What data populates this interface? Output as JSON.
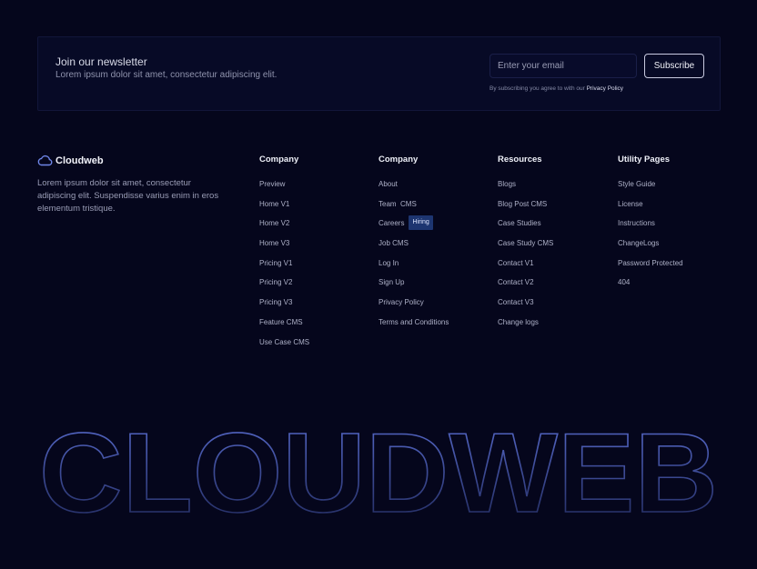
{
  "newsletter": {
    "title": "Join our newsletter",
    "description": "Lorem ipsum dolor sit amet, consectetur adipiscing elit.",
    "email_placeholder": "Enter your email",
    "email_value": "",
    "subscribe_label": "Subscribe",
    "note_prefix": "By subscribing you agree to with our",
    "note_link": "Privacy Policy"
  },
  "brand": {
    "name": "Cloudweb",
    "icon": "cloud-icon",
    "description": "Lorem ipsum dolor sit amet, consectetur adipiscing elit. Suspendisse varius enim in eros elementum tristique."
  },
  "columns": [
    {
      "title": "Company",
      "items": [
        "Preview",
        "Home V1",
        "Home V2",
        "Home V3",
        "Pricing V1",
        "Pricing V2",
        "Pricing V3",
        "Feature CMS",
        "Use Case CMS"
      ]
    },
    {
      "title": "Company",
      "items": [
        "About",
        "Team  CMS",
        "Careers",
        "Job CMS",
        "Log In",
        "Sign Up",
        "Privacy Policy",
        "Terms and Conditions"
      ],
      "badge": "Hiring"
    },
    {
      "title": "Resources",
      "items": [
        "Blogs",
        "Blog Post CMS",
        "Case Studies",
        "Case Study CMS",
        "Contact V1",
        "Contact V2",
        "Contact V3",
        "Change logs"
      ]
    },
    {
      "title": "Utility Pages",
      "items": [
        "Style Guide",
        "License",
        "Instructions",
        "ChangeLogs",
        "Password Protected",
        "404"
      ]
    }
  ],
  "big_word": "CLOUDWEB",
  "colors": {
    "background": "#05061c",
    "panel": "#070a26",
    "badge": "#1d3570",
    "outline_start": "#20285a",
    "outline_end": "#5c6fd0"
  }
}
